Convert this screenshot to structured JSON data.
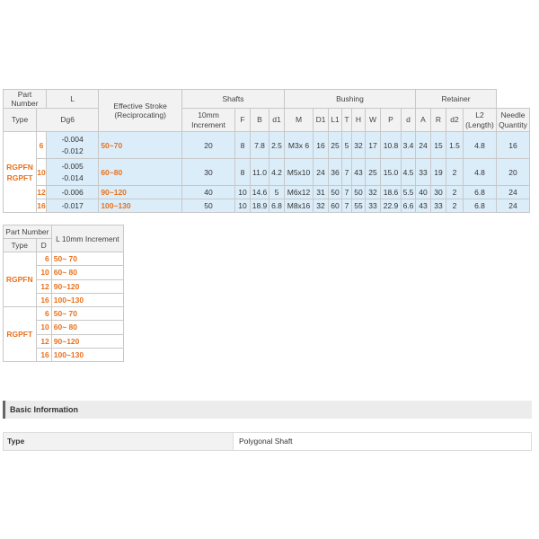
{
  "spec_table": {
    "headers": {
      "part_number": "Part Number",
      "type": "Type",
      "dg6": "Dg6",
      "l": "L",
      "l_sub": [
        "10mm",
        "Increment"
      ],
      "stroke": [
        "Effective Stroke",
        "(Reciprocating)"
      ],
      "shafts": "Shafts",
      "bushing": "Bushing",
      "retainer": "Retainer",
      "shaft_cols": [
        "F",
        "B",
        "d1",
        "M"
      ],
      "bushing_cols": [
        "D1",
        "L1",
        "T",
        "H",
        "W",
        "P",
        "d",
        "A"
      ],
      "retainer_cols": [
        "R",
        "d2"
      ],
      "l2": [
        "L2",
        "(Length)"
      ],
      "needle": [
        "Needle",
        "Quantity"
      ]
    },
    "types": [
      "RGPFN",
      "RGPFT"
    ],
    "rows": [
      {
        "d": "6",
        "tol": [
          "-0.004",
          "-0.012"
        ],
        "l": "50~70",
        "stroke": "20",
        "F": "8",
        "B": "7.8",
        "d1": "2.5",
        "M": "M3x 6",
        "D1": "16",
        "L1": "25",
        "T": "5",
        "H": "32",
        "W": "17",
        "P": "10.8",
        "dd": "3.4",
        "A": "24",
        "R": "15",
        "d2": "1.5",
        "L2": "4.8",
        "N": "16"
      },
      {
        "d": "10",
        "tol": [
          "-0.005",
          "-0.014"
        ],
        "l": "60~80",
        "stroke": "30",
        "F": "8",
        "B": "11.0",
        "d1": "4.2",
        "M": "M5x10",
        "D1": "24",
        "L1": "36",
        "T": "7",
        "H": "43",
        "W": "25",
        "P": "15.0",
        "dd": "4.5",
        "A": "33",
        "R": "19",
        "d2": "2",
        "L2": "4.8",
        "N": "20"
      },
      {
        "d": "12",
        "tol": [
          "-0.006"
        ],
        "l": "90~120",
        "stroke": "40",
        "F": "10",
        "B": "14.6",
        "d1": "5",
        "M": "M6x12",
        "D1": "31",
        "L1": "50",
        "T": "7",
        "H": "50",
        "W": "32",
        "P": "18.6",
        "dd": "5.5",
        "A": "40",
        "R": "30",
        "d2": "2",
        "L2": "6.8",
        "N": "24"
      },
      {
        "d": "16",
        "tol": [
          "-0.017"
        ],
        "l": "100~130",
        "stroke": "50",
        "F": "10",
        "B": "18.9",
        "d1": "6.8",
        "M": "M8x16",
        "D1": "32",
        "L1": "60",
        "T": "7",
        "H": "55",
        "W": "33",
        "P": "22.9",
        "dd": "6.6",
        "A": "43",
        "R": "33",
        "d2": "2",
        "L2": "6.8",
        "N": "24"
      }
    ]
  },
  "small_table": {
    "headers": {
      "part_number": "Part Number",
      "type": "Type",
      "d": "D",
      "l": "L 10mm Increment"
    },
    "groups": [
      {
        "type": "RGPFN",
        "rows": [
          {
            "d": "6",
            "l": "50~ 70"
          },
          {
            "d": "10",
            "l": "60~ 80"
          },
          {
            "d": "12",
            "l": "90~120"
          },
          {
            "d": "16",
            "l": "100~130"
          }
        ]
      },
      {
        "type": "RGPFT",
        "rows": [
          {
            "d": "6",
            "l": "50~ 70"
          },
          {
            "d": "10",
            "l": "60~ 80"
          },
          {
            "d": "12",
            "l": "90~120"
          },
          {
            "d": "16",
            "l": "100~130"
          }
        ]
      }
    ]
  },
  "basic_info": {
    "title": "Basic Information",
    "label": "Type",
    "value": "Polygonal Shaft"
  }
}
